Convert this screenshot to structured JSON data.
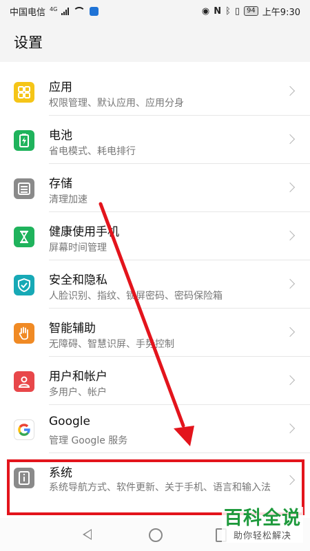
{
  "status": {
    "carrier": "中国电信",
    "network": "4G",
    "battery": "94",
    "time": "上午9:30"
  },
  "header": {
    "title": "设置"
  },
  "items": [
    {
      "title": "应用",
      "sub": "权限管理、默认应用、应用分身",
      "icon": "apps-grid-icon",
      "color": "#f5c518"
    },
    {
      "title": "电池",
      "sub": "省电模式、耗电排行",
      "icon": "battery-icon",
      "color": "#1fb35c"
    },
    {
      "title": "存储",
      "sub": "清理加速",
      "icon": "storage-icon",
      "color": "#8a8a8a"
    },
    {
      "title": "健康使用手机",
      "sub": "屏幕时间管理",
      "icon": "hourglass-icon",
      "color": "#1fb35c"
    },
    {
      "title": "安全和隐私",
      "sub": "人脸识别、指纹、锁屏密码、密码保险箱",
      "icon": "shield-icon",
      "color": "#17a9b6"
    },
    {
      "title": "智能辅助",
      "sub": "无障碍、智慧识屏、手势控制",
      "icon": "hand-icon",
      "color": "#f08a24"
    },
    {
      "title": "用户和帐户",
      "sub": "多用户、帐户",
      "icon": "user-icon",
      "color": "#e8474a"
    },
    {
      "title": "Google",
      "sub": "管理 Google 服务",
      "icon": "google-icon",
      "color": "#ffffff"
    },
    {
      "title": "系统",
      "sub": "系统导航方式、软件更新、关于手机、语言和输入法",
      "icon": "system-info-icon",
      "color": "#8a8a8a"
    }
  ],
  "watermark": {
    "main": "百科全说",
    "sub": "助你轻松解决"
  },
  "annotation_color": "#e3141c"
}
